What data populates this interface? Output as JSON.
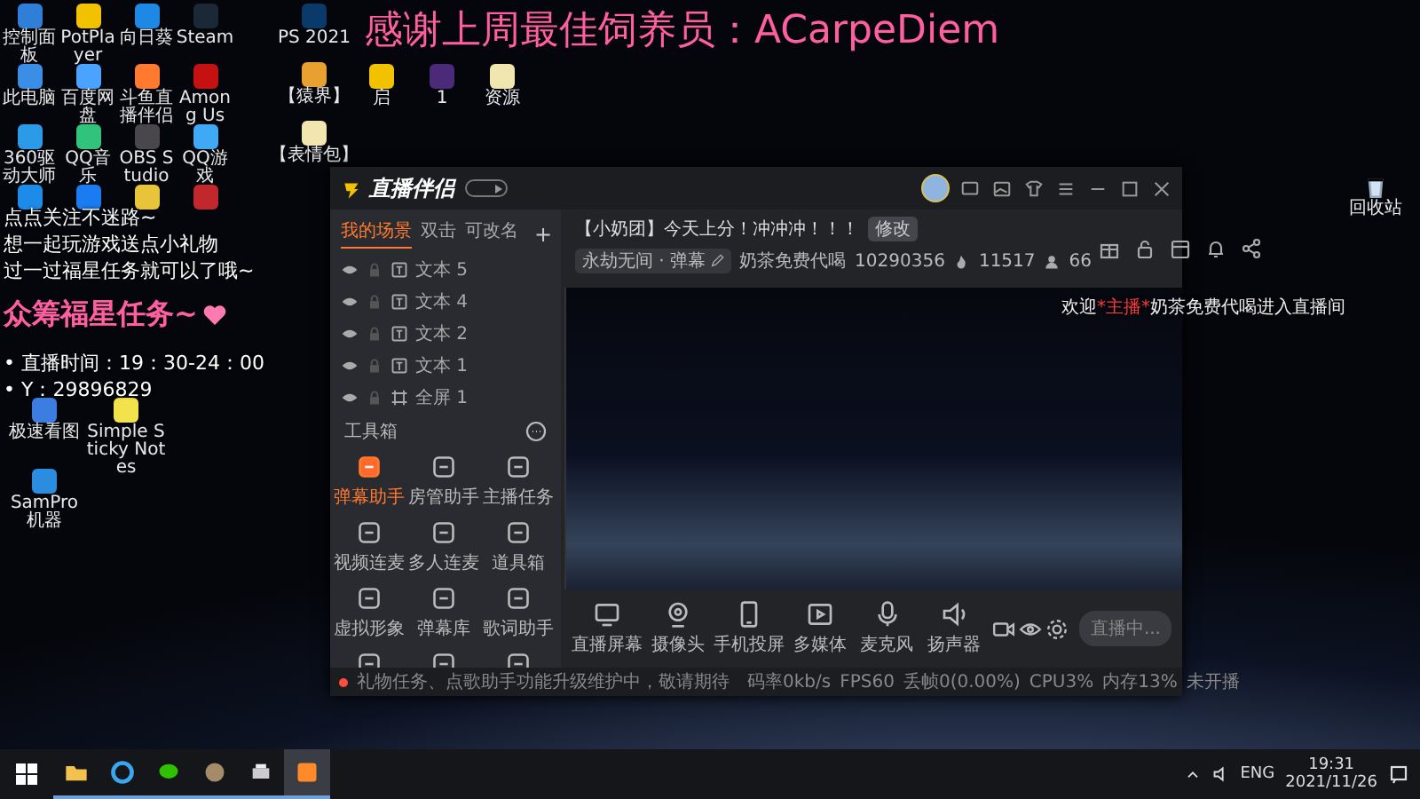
{
  "desktop": {
    "icons": [
      {
        "label": "控制面板",
        "color": "#2f7fd8"
      },
      {
        "label": "PotPlayer",
        "color": "#f2c200"
      },
      {
        "label": "向日葵",
        "color": "#1e88e5"
      },
      {
        "label": "Steam",
        "color": "#1b2838"
      },
      {
        "label": "此电脑",
        "color": "#3a8ee6"
      },
      {
        "label": "百度网盘",
        "color": "#4aa3ff"
      },
      {
        "label": "斗鱼直播伴侣",
        "color": "#ff7a2f"
      },
      {
        "label": "Among Us",
        "color": "#c51111"
      },
      {
        "label": "360驱动大师",
        "color": "#2b9be8"
      },
      {
        "label": "QQ音乐",
        "color": "#31c27c"
      },
      {
        "label": "OBS Studio",
        "color": "#4a474c"
      },
      {
        "label": "QQ游戏",
        "color": "#3fa9f5"
      },
      {
        "color": "#1d8be8"
      },
      {
        "color": "#1a7cf0"
      },
      {
        "color": "#e8c43a"
      },
      {
        "color": "#c0282d"
      }
    ],
    "lower_icons": [
      {
        "label": "极速看图",
        "color": "#3b7de0"
      },
      {
        "label": "Simple Sticky Notes",
        "color": "#f2e24b"
      },
      {
        "label": "SamPro 机器",
        "color": "#2a8de0"
      }
    ],
    "column_2": [
      {
        "label": "PS 2021",
        "color": "#0a3a6a"
      },
      {
        "label": "【猿界】",
        "color": "#e8a030"
      },
      {
        "label": "【表情包】",
        "color": "#f1e6b0"
      }
    ],
    "row_2": [
      {
        "label": "启",
        "color": "#f2c200"
      },
      {
        "label": "1",
        "color": "#4b2a7a"
      },
      {
        "label": "资源",
        "color": "#f1e6b0"
      }
    ],
    "recycle_bin": {
      "label": "回收站"
    }
  },
  "overlay": {
    "banner": "感谢上周最佳饲养员：ACarpeDiem",
    "notes": [
      "点点关注不迷路~",
      "想一起玩游戏送点小礼物",
      "过一过福星任务就可以了哦~"
    ],
    "highlight": "众筹福星任务~",
    "schedule": [
      "• 直播时间：19：30-24：00",
      "• Y：29896829"
    ],
    "welcome": {
      "prefix": "欢迎",
      "name": "*主播*",
      "suffix": "奶茶免费代喝进入直播间"
    }
  },
  "app": {
    "title": "直播伴侣",
    "tabs": [
      {
        "label": "我的场景",
        "selected": true
      },
      {
        "label": "双击",
        "selected": false
      },
      {
        "label": "可改名",
        "selected": false
      }
    ],
    "add": "+",
    "scenes": [
      {
        "label": "文本 5",
        "kind": "text"
      },
      {
        "label": "文本 4",
        "kind": "text"
      },
      {
        "label": "文本 2",
        "kind": "text"
      },
      {
        "label": "文本 1",
        "kind": "text"
      },
      {
        "label": "全屏 1",
        "kind": "screen"
      }
    ],
    "toolbox": {
      "title": "工具箱",
      "tools": [
        {
          "label": "弹幕助手",
          "selected": true
        },
        {
          "label": "房管助手",
          "selected": false
        },
        {
          "label": "主播任务",
          "selected": false
        },
        {
          "label": "视频连麦",
          "selected": false
        },
        {
          "label": "多人连麦",
          "selected": false
        },
        {
          "label": "道具箱",
          "selected": false
        },
        {
          "label": "虚拟形象",
          "selected": false
        },
        {
          "label": "弹幕库",
          "selected": false
        },
        {
          "label": "歌词助手",
          "selected": false
        },
        {
          "selected": false
        },
        {
          "selected": false
        },
        {
          "selected": false
        }
      ]
    },
    "stream": {
      "title": "【小奶团】今天上分！冲冲冲！！！",
      "edit": "修改",
      "category": "永劫无间 · 弹幕",
      "name": "奶茶免费代喝",
      "room": "10290356",
      "heat": "11517",
      "viewers": "66"
    },
    "controls": [
      {
        "label": "直播屏幕",
        "kind": "screen"
      },
      {
        "label": "摄像头",
        "kind": "camera"
      },
      {
        "label": "手机投屏",
        "kind": "phone"
      },
      {
        "label": "多媒体",
        "kind": "media"
      },
      {
        "label": "麦克风",
        "kind": "mic"
      },
      {
        "label": "扬声器",
        "kind": "speaker"
      }
    ],
    "live_button": "直播中...",
    "status": {
      "notice": "礼物任务、点歌助手功能升级维护中，敬请期待",
      "stats": [
        "码率0kb/s",
        "FPS60",
        "丢帧0(0.00%)",
        "CPU3%",
        "内存13%"
      ],
      "state": "未开播"
    }
  },
  "taskbar": {
    "apps": [
      {
        "kind": "folder",
        "active": false
      },
      {
        "kind": "browser",
        "active": false
      },
      {
        "kind": "chat",
        "active": false
      },
      {
        "kind": "game",
        "active": false
      },
      {
        "kind": "printer",
        "active": false
      },
      {
        "kind": "stream",
        "active": true
      }
    ],
    "language": "ENG",
    "time": "19:31",
    "date": "2021/11/26"
  }
}
